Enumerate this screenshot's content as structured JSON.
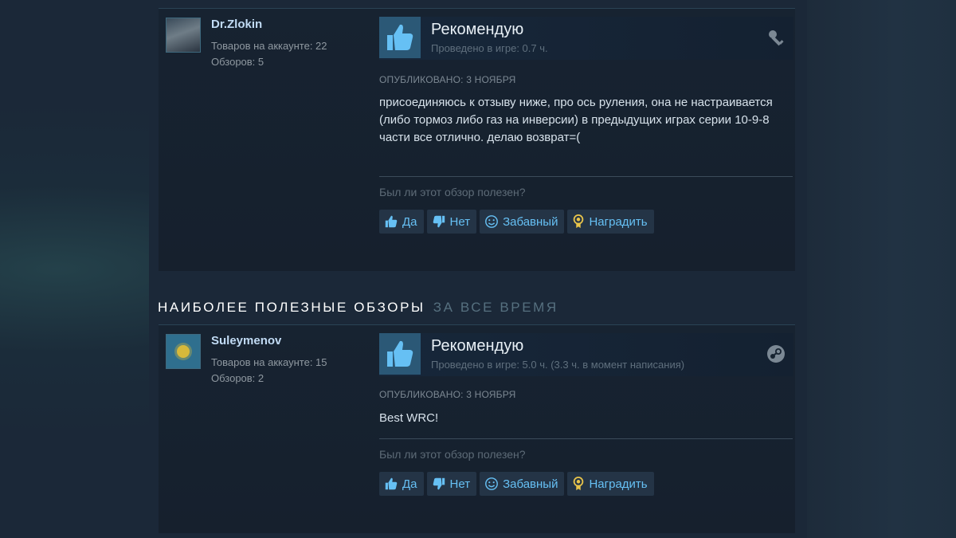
{
  "reviews": [
    {
      "author": {
        "name": "Dr.Zlokin",
        "products": "Товаров на аккаунте: 22",
        "reviews": "Обзоров: 5"
      },
      "verdict": "Рекомендую",
      "hours": "Проведено в игре: 0.7 ч.",
      "source_icon": "key-icon",
      "posted": "ОПУБЛИКОВАНО: 3 НОЯБРЯ",
      "body": "присоединяюсь к отзыву ниже, про ось руления, она не настраивается (либо тормоз либо газ на инверсии) в предыдущих играх серии 10-9-8 части все отлично. делаю возврат=("
    },
    {
      "author": {
        "name": "Suleymenov",
        "products": "Товаров на аккаунте: 15",
        "reviews": "Обзоров: 2"
      },
      "verdict": "Рекомендую",
      "hours": "Проведено в игре: 5.0 ч. (3.3 ч. в момент написания)",
      "source_icon": "steam-icon",
      "posted": "ОПУБЛИКОВАНО: 3 НОЯБРЯ",
      "body": "Best WRC!"
    }
  ],
  "helpful_question": "Был ли этот обзор полезен?",
  "buttons": {
    "yes": "Да",
    "no": "Нет",
    "funny": "Забавный",
    "award": "Наградить"
  },
  "section": {
    "title": "НАИБОЛЕЕ ПОЛЕЗНЫЕ ОБЗОРЫ",
    "subtitle": "ЗА ВСЕ ВРЕМЯ"
  },
  "colors": {
    "accent": "#66c0f4",
    "thumb_bg": "#2b5876",
    "page_bg": "#1b2838"
  }
}
